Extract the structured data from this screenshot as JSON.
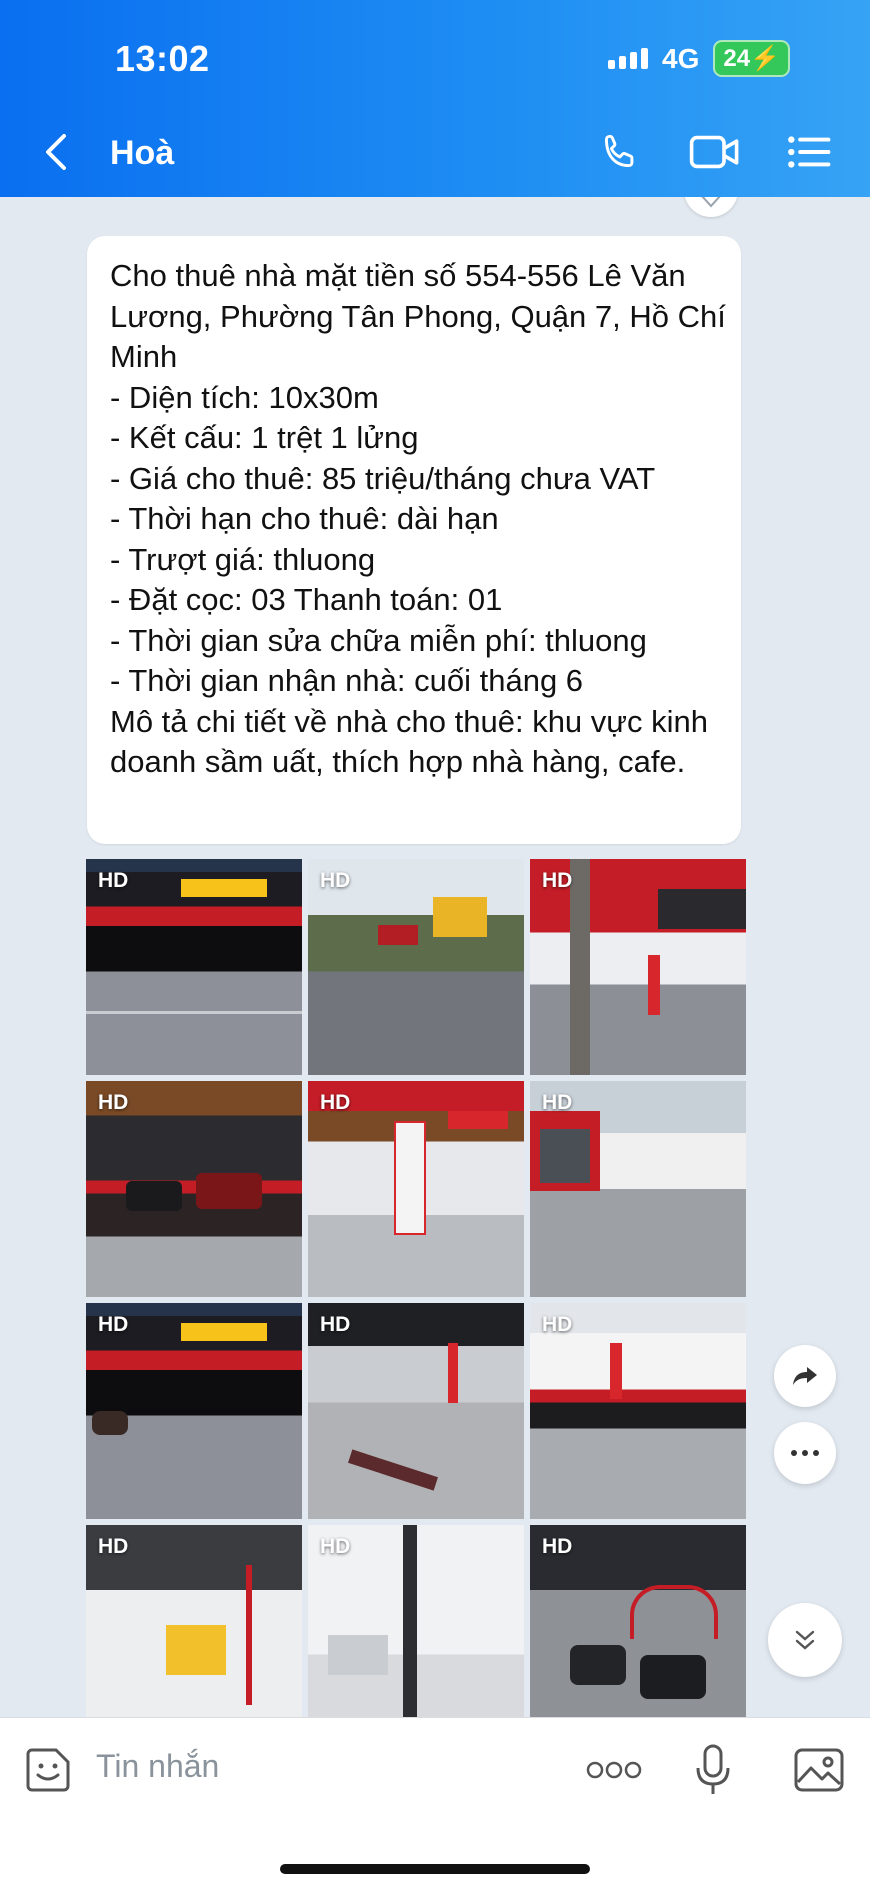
{
  "status_bar": {
    "time": "13:02",
    "network": "4G",
    "battery": "24"
  },
  "header": {
    "contact_name": "Hoà"
  },
  "message": {
    "text": "Cho thuê nhà mặt tiền số 554-556  Lê Văn Lương, Phường Tân Phong, Quận 7, Hồ Chí Minh\n- Diện tích: 10x30m\n- Kết cấu: 1 trệt 1 lửng\n- Giá cho thuê: 85 triệu/tháng chưa VAT\n- Thời hạn cho thuê: dài hạn\n- Trượt giá: thluong\n- Đặt cọc: 03 Thanh toán: 01\n- Thời gian sửa chữa miễn phí: thluong\n- Thời gian nhận nhà: cuối tháng 6\nMô tả chi tiết về nhà cho thuê: khu vực kinh doanh sầm uất, thích hợp nhà hàng, cafe."
  },
  "photos": [
    {
      "badge": "HD"
    },
    {
      "badge": "HD"
    },
    {
      "badge": "HD"
    },
    {
      "badge": "HD"
    },
    {
      "badge": "HD"
    },
    {
      "badge": "HD"
    },
    {
      "badge": "HD"
    },
    {
      "badge": "HD"
    },
    {
      "badge": "HD"
    },
    {
      "badge": "HD"
    },
    {
      "badge": "HD"
    },
    {
      "badge": "HD"
    }
  ],
  "composer": {
    "placeholder": "Tin nhắn"
  },
  "icons": {
    "back": "back-arrow-icon",
    "call": "phone-icon",
    "video": "video-camera-icon",
    "menu": "list-menu-icon",
    "share": "share-arrow-icon",
    "more": "more-dots-icon",
    "scroll": "double-chevron-down-icon",
    "sticker": "emoji-sticker-icon",
    "extra": "three-dots-icon",
    "mic": "microphone-icon",
    "image": "image-icon"
  },
  "colors": {
    "header_blue": "#1a87f2",
    "chat_background": "#e2e9f1",
    "brand_red": "#d7262c"
  }
}
